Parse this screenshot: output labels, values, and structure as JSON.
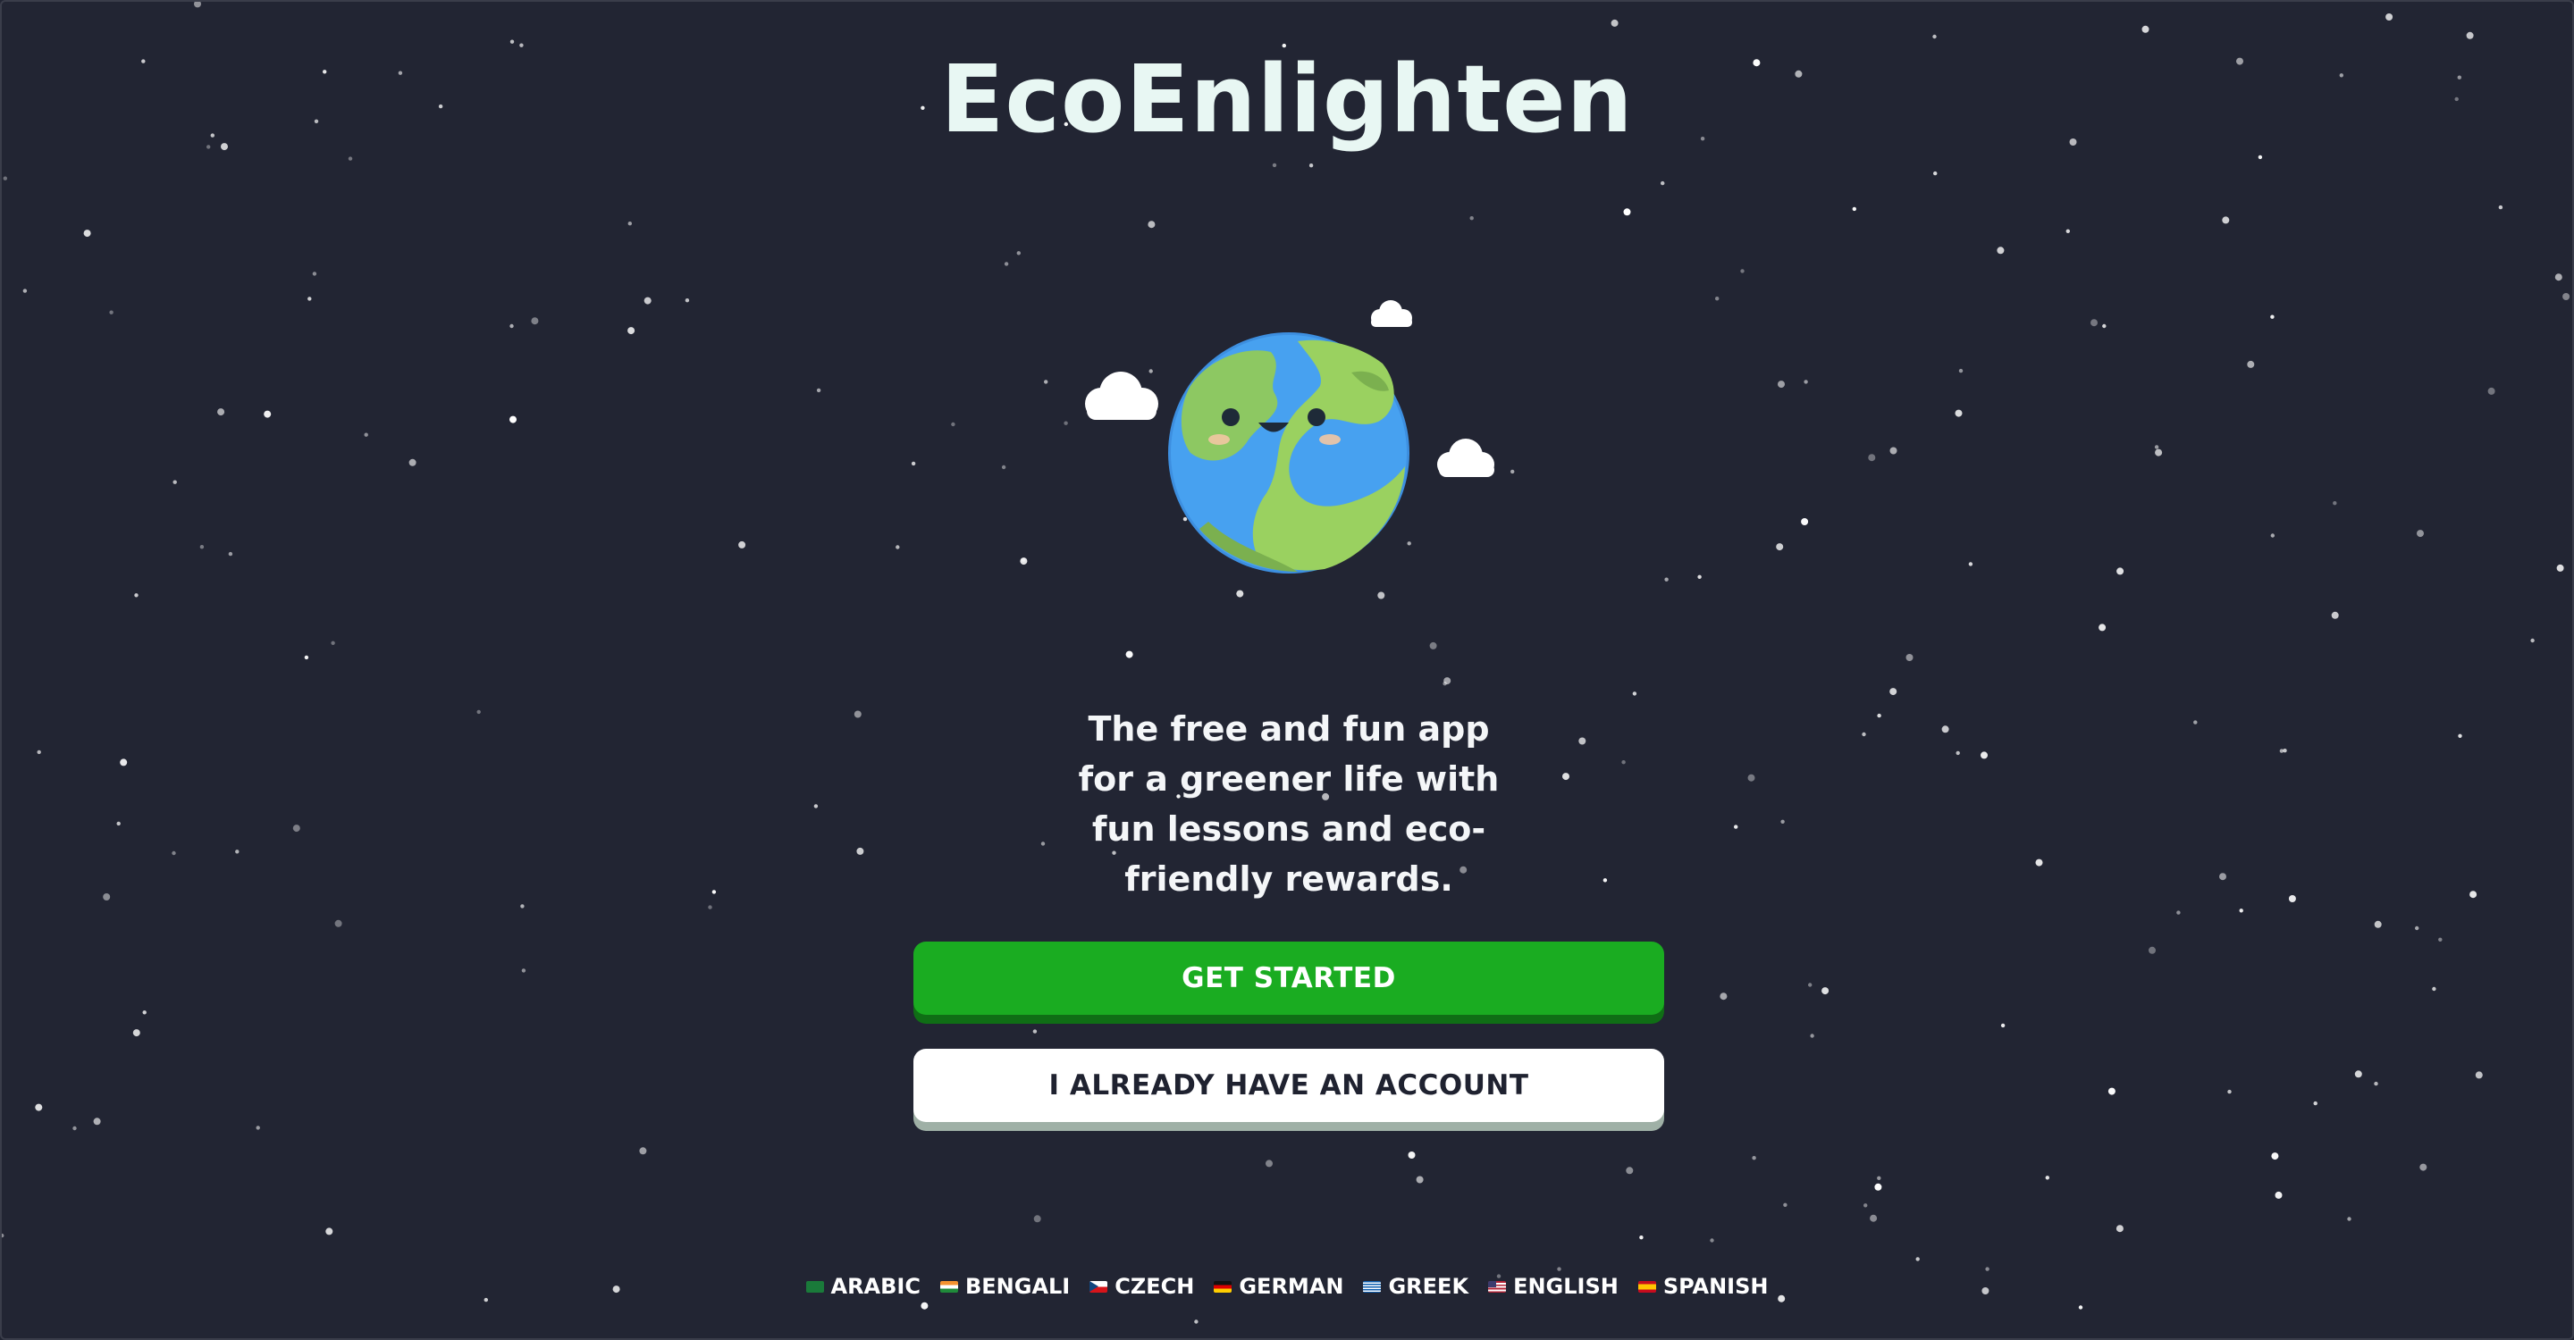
{
  "app": {
    "title": "EcoEnlighten"
  },
  "hero": {
    "illustration": "smiling-earth-with-clouds",
    "tagline": "The free and fun app for a greener life with fun lessons and eco-friendly rewards."
  },
  "actions": {
    "get_started_label": "GET STARTED",
    "login_label": "I ALREADY HAVE AN ACCOUNT"
  },
  "languages": [
    {
      "label": "ARABIC",
      "flag": "sa-flag-icon"
    },
    {
      "label": "BENGALI",
      "flag": "in-flag-icon"
    },
    {
      "label": "CZECH",
      "flag": "cz-flag-icon"
    },
    {
      "label": "GERMAN",
      "flag": "de-flag-icon"
    },
    {
      "label": "GREEK",
      "flag": "gr-flag-icon"
    },
    {
      "label": "ENGLISH",
      "flag": "us-flag-icon"
    },
    {
      "label": "SPANISH",
      "flag": "es-flag-icon"
    }
  ],
  "colors": {
    "background": "#222533",
    "primary_button": "#1aac21",
    "primary_button_shadow": "#0f6e15",
    "secondary_button": "#ffffff",
    "title": "#e8f7f3"
  }
}
